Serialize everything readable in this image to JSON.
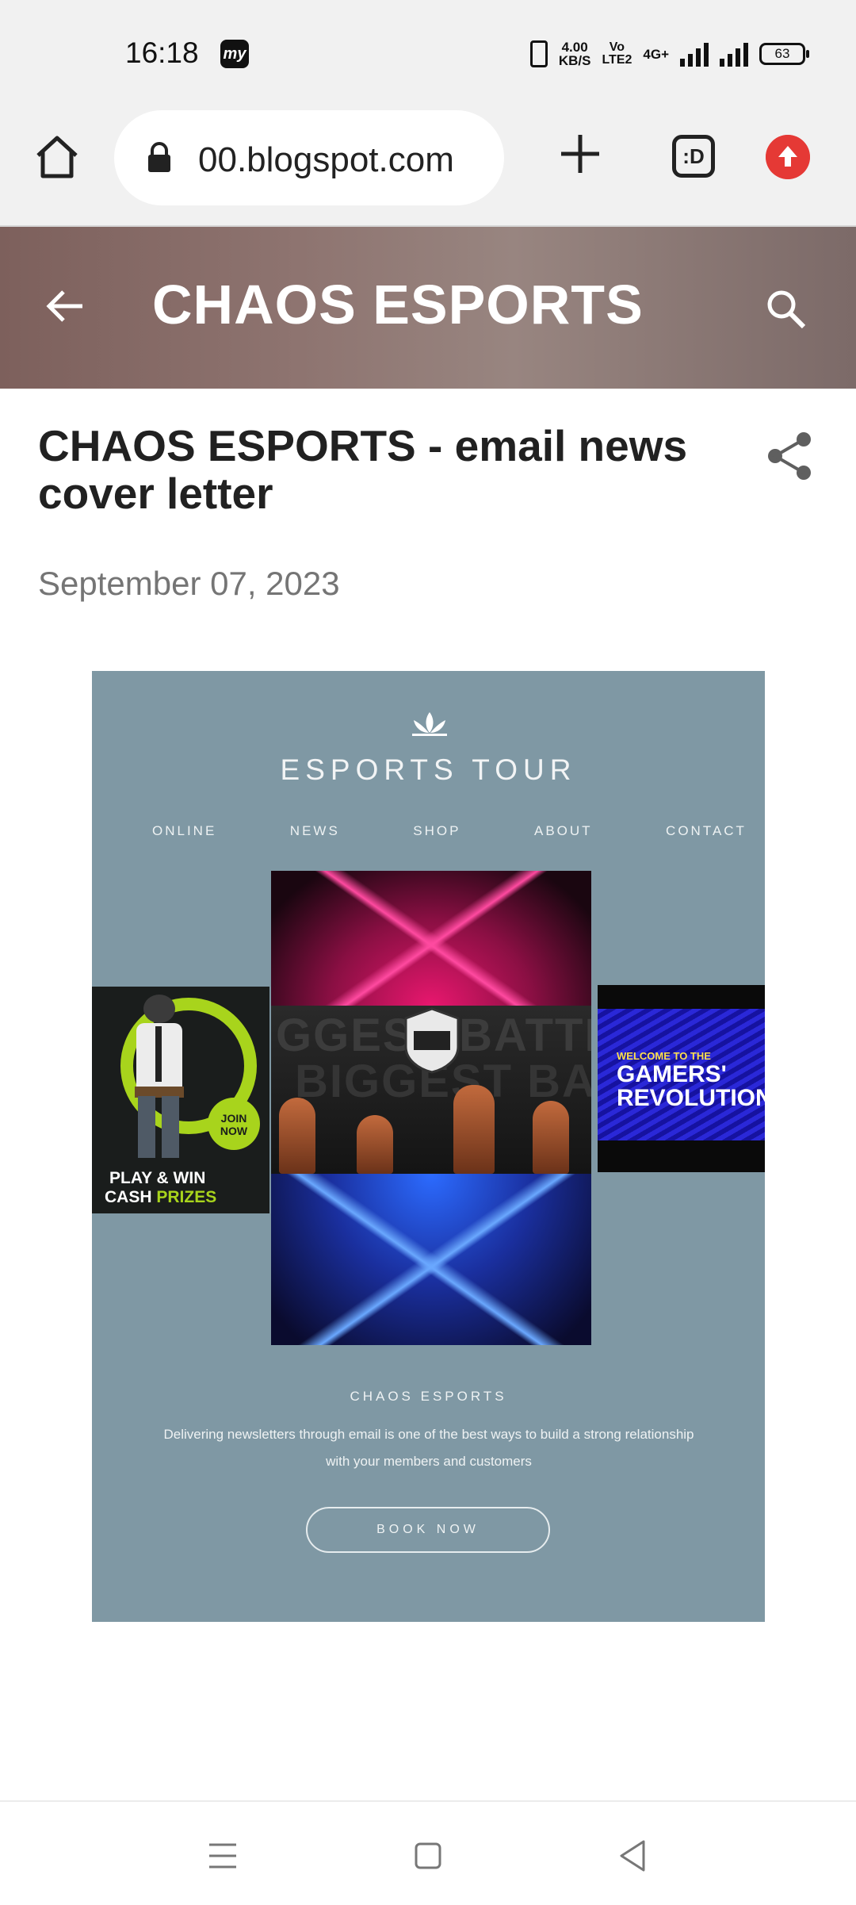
{
  "status_bar": {
    "time": "16:18",
    "app_icon_label": "my",
    "net_speed_value": "4.00",
    "net_speed_unit": "KB/S",
    "volte_top": "Vo",
    "volte_bottom": "LTE2",
    "network_type": "4G+",
    "battery_level": "63"
  },
  "browser": {
    "url": "00.blogspot.com",
    "tab_switcher_label": ":D",
    "icons": [
      "home-icon",
      "lock-icon",
      "plus-icon",
      "tab-switcher-icon",
      "update-icon"
    ]
  },
  "blog": {
    "title": "CHAOS ESPORTS",
    "icons": [
      "back-arrow-icon",
      "search-icon"
    ]
  },
  "post": {
    "title": "CHAOS ESPORTS - email news cover letter",
    "date": "September 07, 2023",
    "share_icon": "share-icon"
  },
  "poster": {
    "brand": "ESPORTS TOUR",
    "nav": [
      "ONLINE",
      "NEWS",
      "SHOP",
      "ABOUT",
      "CONTACT"
    ],
    "ghost_text_1": "GGEST BATTLE",
    "ghost_text_2": "BIGGEST BATT",
    "left_ad_line1": "PLAY & WIN",
    "left_ad_line2_a": "CASH",
    "left_ad_line2_b": "PRIZES",
    "left_ad_join": "JOIN NOW",
    "right_ad_line1": "WELCOME TO THE",
    "right_ad_line2": "GAMERS' REVOLUTION",
    "name": "CHAOS ESPORTS",
    "description": "Delivering newsletters through email is one of the best ways to build a strong relationship with your members and customers",
    "cta": "BOOK NOW",
    "background_color": "#7f98a4"
  },
  "navigation_bar": {
    "icons": [
      "menu-icon",
      "home-square-icon",
      "back-triangle-icon"
    ]
  },
  "colors": {
    "header_brown": "#8e7470",
    "update_red": "#e53935",
    "lime_accent": "#a8d41c"
  }
}
